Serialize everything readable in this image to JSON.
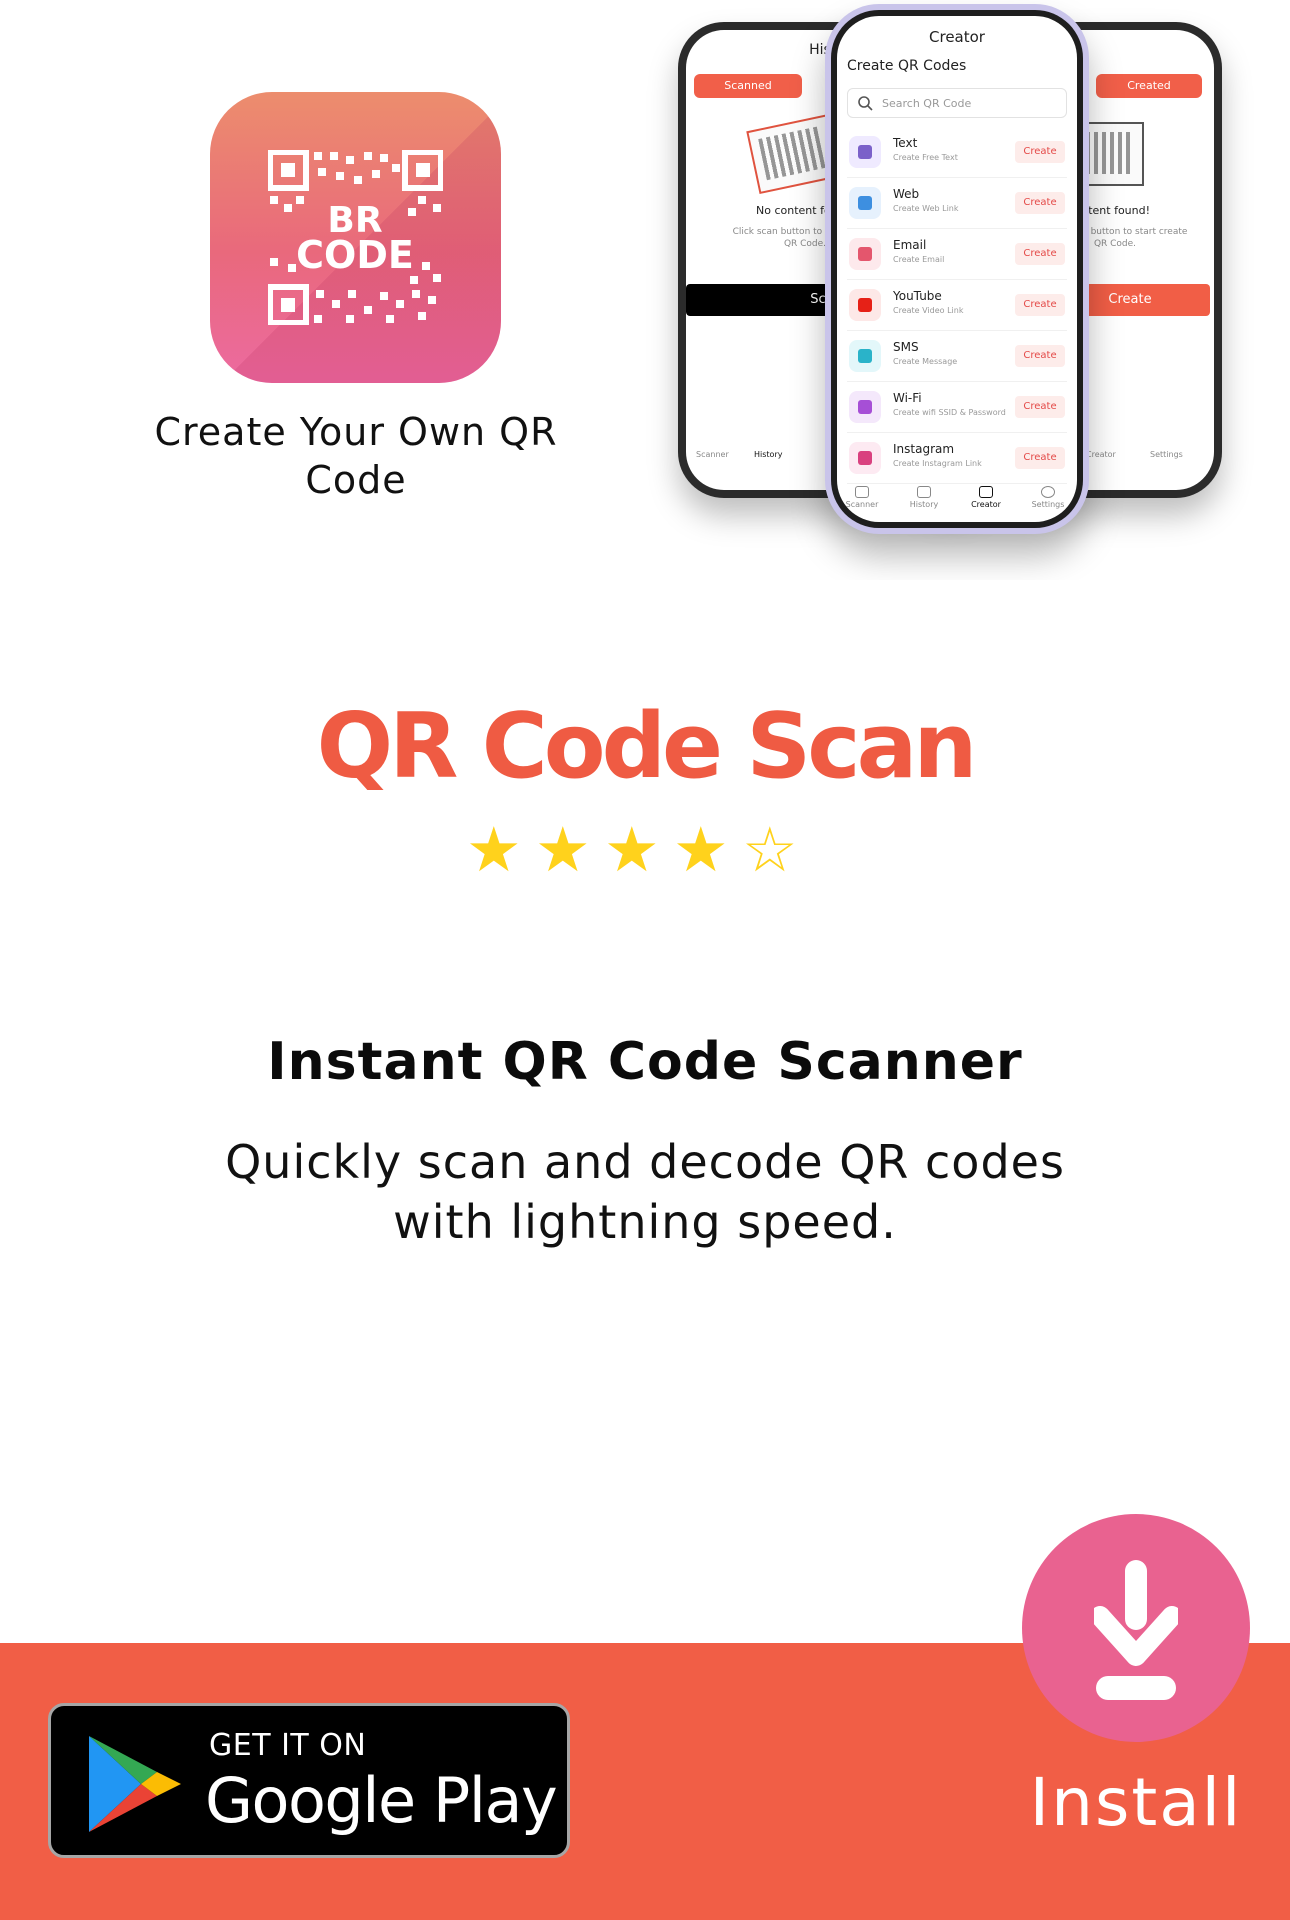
{
  "app_icon": {
    "icon": "qr-code-app-icon",
    "logo_text": "BR CODE"
  },
  "icon_caption": "Create Your Own QR Code",
  "mockups": {
    "left_phone": {
      "title": "History",
      "tab_active": "Scanned",
      "empty_title": "No content found!",
      "empty_hint": "Click scan button to start create QR Code.",
      "action_button": "Scan"
    },
    "right_phone": {
      "title": "History",
      "tab_active": "Created",
      "empty_title": "No content found!",
      "empty_hint": "Click scan button to start create QR Code.",
      "action_button": "Create"
    },
    "center_phone": {
      "title": "Creator",
      "subtitle": "Create QR Codes",
      "search_placeholder": "Search QR Code",
      "items": [
        {
          "name": "Text",
          "desc": "Create Free Text",
          "action": "Create",
          "icon": "text-icon",
          "color": "#7b61c9",
          "bg": "#efeaff"
        },
        {
          "name": "Web",
          "desc": "Create Web Link",
          "action": "Create",
          "icon": "globe-icon",
          "color": "#3d8fe0",
          "bg": "#e6f1fd"
        },
        {
          "name": "Email",
          "desc": "Create Email",
          "action": "Create",
          "icon": "mail-icon",
          "color": "#e4566d",
          "bg": "#fde9ec"
        },
        {
          "name": "YouTube",
          "desc": "Create Video Link",
          "action": "Create",
          "icon": "youtube-icon",
          "color": "#e62117",
          "bg": "#fde8e7"
        },
        {
          "name": "SMS",
          "desc": "Create Message",
          "action": "Create",
          "icon": "chat-icon",
          "color": "#2ab3c9",
          "bg": "#e3f7fa"
        },
        {
          "name": "Wi-Fi",
          "desc": "Create wifi SSID & Password",
          "action": "Create",
          "icon": "wifi-icon",
          "color": "#a64fd6",
          "bg": "#f4e8fb"
        },
        {
          "name": "Instagram",
          "desc": "Create Instagram Link",
          "action": "Create",
          "icon": "instagram-icon",
          "color": "#d9417f",
          "bg": "#fdeaf2"
        }
      ],
      "nav": [
        "Scanner",
        "History",
        "Creator",
        "Settings"
      ],
      "nav_active": "Creator"
    }
  },
  "headline": "QR Code Scan",
  "rating": {
    "value": 4,
    "max": 5
  },
  "feature": {
    "title": "Instant QR Code Scanner",
    "description": "Quickly scan and decode QR codes with lightning speed."
  },
  "store_badge": {
    "line1": "GET IT ON",
    "line2": "Google Play",
    "icon": "google-play-icon"
  },
  "install": {
    "label": "Install",
    "icon": "download-icon"
  },
  "colors": {
    "accent": "#f15e46",
    "headline": "#ef5b43",
    "install_circle": "#e96290",
    "star": "#ffd21c"
  }
}
